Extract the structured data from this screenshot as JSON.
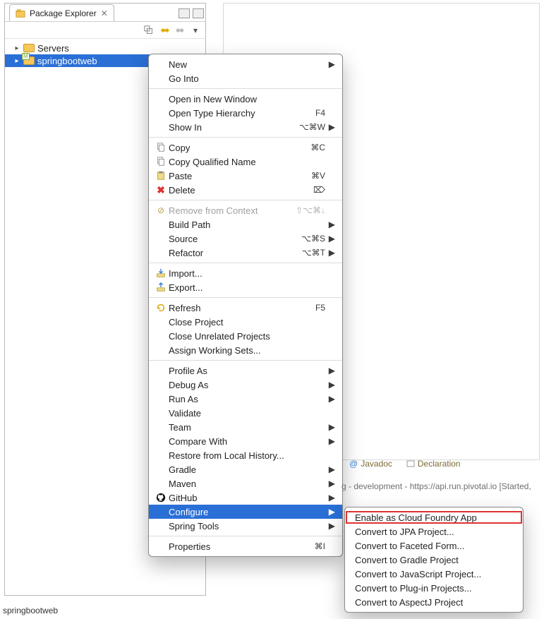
{
  "view": {
    "title": "Package Explorer"
  },
  "tree": {
    "items": [
      {
        "label": "Servers",
        "expanded": false,
        "selected": false,
        "type": "folder"
      },
      {
        "label": "springbootweb",
        "expanded": false,
        "selected": true,
        "type": "project"
      }
    ]
  },
  "contextMenu": {
    "groups": [
      [
        {
          "label": "New",
          "submenu": true
        },
        {
          "label": "Go Into"
        }
      ],
      [
        {
          "label": "Open in New Window"
        },
        {
          "label": "Open Type Hierarchy",
          "accel": "F4"
        },
        {
          "label": "Show In",
          "accel": "⌥⌘W",
          "submenu": true
        }
      ],
      [
        {
          "label": "Copy",
          "icon": "copy",
          "accel": "⌘C"
        },
        {
          "label": "Copy Qualified Name",
          "icon": "copy"
        },
        {
          "label": "Paste",
          "icon": "paste",
          "accel": "⌘V"
        },
        {
          "label": "Delete",
          "icon": "delete",
          "accel": "⌦"
        }
      ],
      [
        {
          "label": "Remove from Context",
          "icon": "remove",
          "accel": "⇧⌥⌘↓",
          "disabled": true
        },
        {
          "label": "Build Path",
          "submenu": true
        },
        {
          "label": "Source",
          "accel": "⌥⌘S",
          "submenu": true
        },
        {
          "label": "Refactor",
          "accel": "⌥⌘T",
          "submenu": true
        }
      ],
      [
        {
          "label": "Import...",
          "icon": "import"
        },
        {
          "label": "Export...",
          "icon": "export"
        }
      ],
      [
        {
          "label": "Refresh",
          "icon": "refresh",
          "accel": "F5"
        },
        {
          "label": "Close Project"
        },
        {
          "label": "Close Unrelated Projects"
        },
        {
          "label": "Assign Working Sets..."
        }
      ],
      [
        {
          "label": "Profile As",
          "submenu": true
        },
        {
          "label": "Debug As",
          "submenu": true
        },
        {
          "label": "Run As",
          "submenu": true
        },
        {
          "label": "Validate"
        },
        {
          "label": "Team",
          "submenu": true
        },
        {
          "label": "Compare With",
          "submenu": true
        },
        {
          "label": "Restore from Local History..."
        },
        {
          "label": "Gradle",
          "submenu": true
        },
        {
          "label": "Maven",
          "submenu": true
        },
        {
          "label": "GitHub",
          "icon": "github",
          "submenu": true
        },
        {
          "label": "Configure",
          "selected": true,
          "submenu": true
        },
        {
          "label": "Spring Tools",
          "submenu": true
        }
      ],
      [
        {
          "label": "Properties",
          "accel": "⌘I"
        }
      ]
    ]
  },
  "submenu": {
    "items": [
      {
        "label": "Enable as Cloud Foundry App",
        "highlight": true
      },
      {
        "label": "Convert to JPA Project..."
      },
      {
        "label": "Convert to Faceted Form..."
      },
      {
        "label": "Convert to Gradle Project"
      },
      {
        "label": "Convert to JavaScript Project..."
      },
      {
        "label": "Convert to Plug-in Projects..."
      },
      {
        "label": "Convert to AspectJ Project"
      }
    ]
  },
  "bgTabs": {
    "items": [
      {
        "label": "Javadoc",
        "icon": "@"
      },
      {
        "label": "Declaration",
        "icon": "decl"
      }
    ]
  },
  "bgStatus": "g - development - https://api.run.pivotal.io  [Started,",
  "statusLine": "springbootweb"
}
